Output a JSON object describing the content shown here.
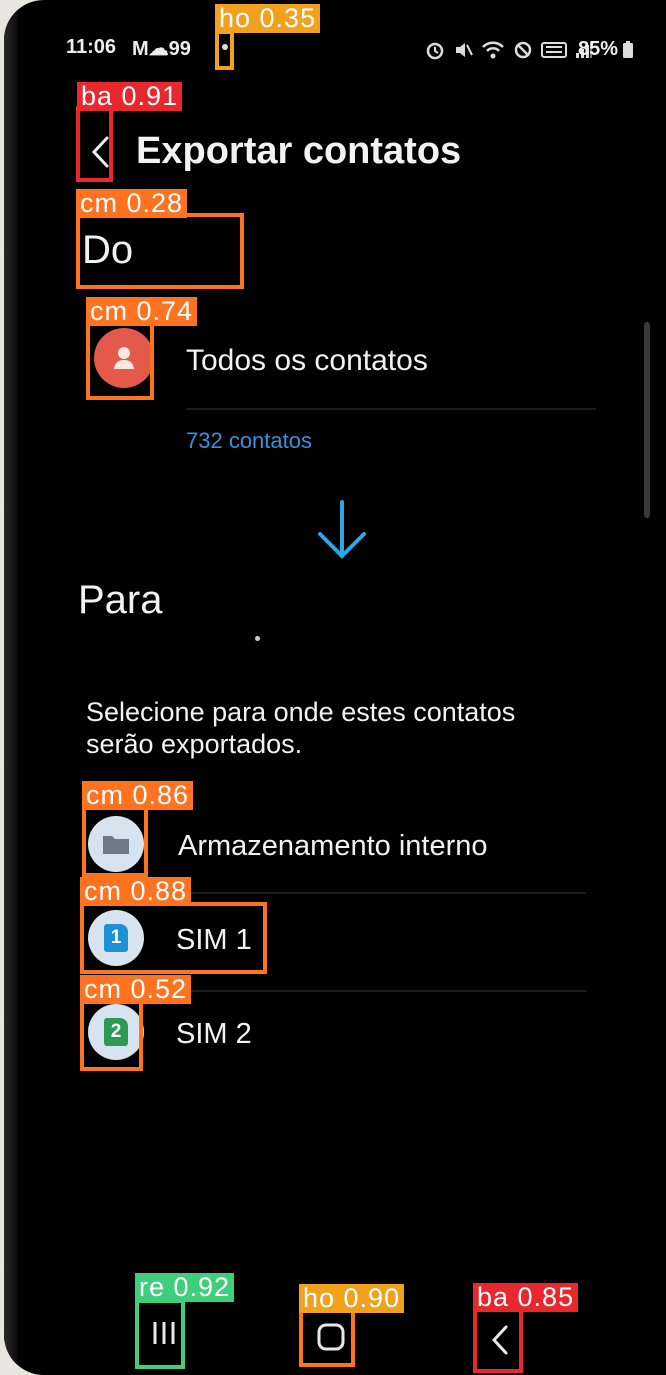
{
  "status_bar": {
    "time": "11:06",
    "left_icons": "M☁99",
    "battery": "85%"
  },
  "header": {
    "title": "Exportar contatos"
  },
  "from_section": {
    "heading": "Do",
    "source_label": "Todos os contatos",
    "source_count": "732 contatos"
  },
  "to_section": {
    "heading": "Para",
    "instruction_line1": "Selecione para onde estes contatos",
    "instruction_line2": "serão exportados.",
    "options": [
      {
        "label": "Armazenamento interno",
        "icon": "folder-icon"
      },
      {
        "label": "SIM 1",
        "icon": "sim-1-icon",
        "badge": "1"
      },
      {
        "label": "SIM 2",
        "icon": "sim-2-icon",
        "badge": "2"
      }
    ]
  },
  "detections": [
    {
      "label": "ho 0.35"
    },
    {
      "label": "ba 0.91"
    },
    {
      "label": "cm 0.28"
    },
    {
      "label": "cm 0.74"
    },
    {
      "label": "cm 0.86"
    },
    {
      "label": "cm 0.88"
    },
    {
      "label": "cm 0.52"
    },
    {
      "label": "re 0.92"
    },
    {
      "label": "ho 0.90"
    },
    {
      "label": "ba 0.85"
    }
  ],
  "colors": {
    "accent_blue": "#2ea6e6",
    "link_blue": "#3a8fe0",
    "avatar_red": "#e35a4b",
    "sim1_blue": "#1f8fd6",
    "sim2_green": "#2d9a53"
  }
}
